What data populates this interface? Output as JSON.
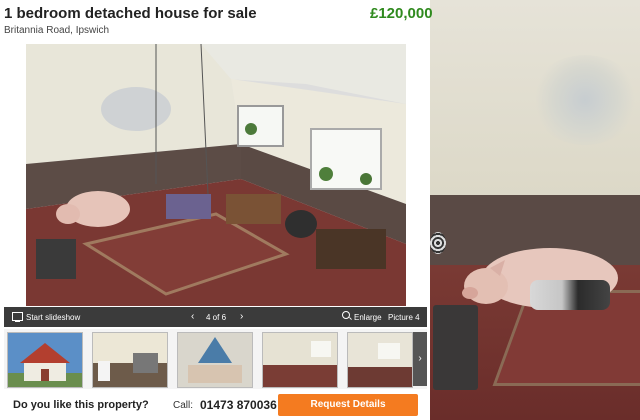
{
  "listing": {
    "title": "1 bedroom detached house for sale",
    "price": "£120,000",
    "address": "Britannia Road, Ipswich"
  },
  "slideshow": {
    "start_label": "Start slideshow",
    "counter": "4 of 6",
    "enlarge_label": "Enlarge",
    "picture_label": "Picture 4"
  },
  "thumbnails": [
    {
      "name": "exterior-photo"
    },
    {
      "name": "kitchen-photo"
    },
    {
      "name": "bedroom-photo"
    },
    {
      "name": "living-room-photo"
    },
    {
      "name": "room-photo"
    }
  ],
  "footer": {
    "question": "Do you like this property?",
    "call_label": "Call:",
    "phone": "01473 870036",
    "request_button": "Request Details"
  },
  "colors": {
    "price_green": "#2f8a1e",
    "button_orange": "#f47b20",
    "bar_dark": "#3b3b3b"
  },
  "icons": [
    "monitor-icon",
    "chevron-left-icon",
    "chevron-right-icon",
    "magnifier-icon",
    "chevron-right-icon"
  ]
}
